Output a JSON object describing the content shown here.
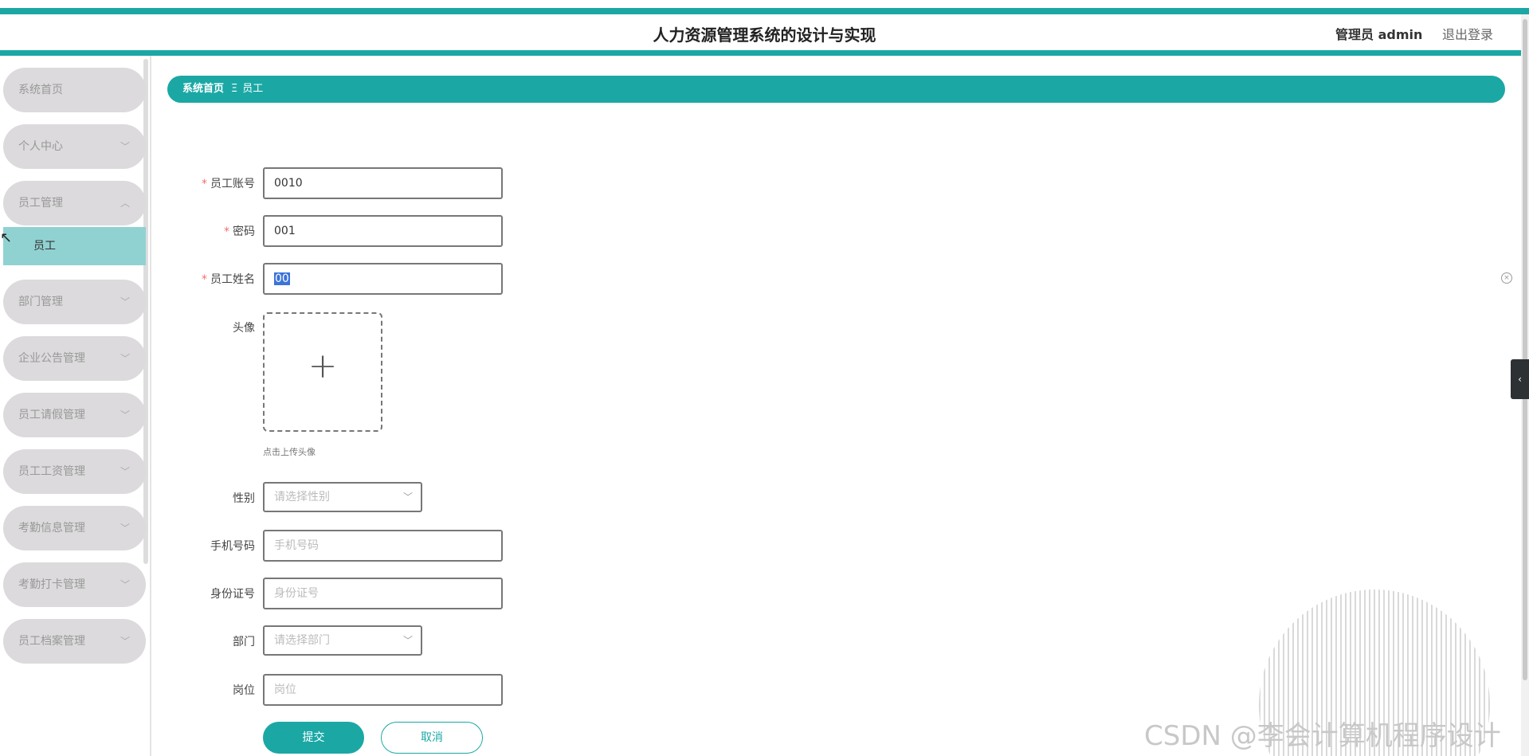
{
  "header": {
    "title": "人力资源管理系统的设计与实现",
    "user": "管理员 admin",
    "logout": "退出登录"
  },
  "sidebar": {
    "items": [
      {
        "label": "系统首页"
      },
      {
        "label": "个人中心"
      },
      {
        "label": "员工管理"
      },
      {
        "label": "部门管理"
      },
      {
        "label": "企业公告管理"
      },
      {
        "label": "员工请假管理"
      },
      {
        "label": "员工工资管理"
      },
      {
        "label": "考勤信息管理"
      },
      {
        "label": "考勤打卡管理"
      },
      {
        "label": "员工档案管理"
      }
    ],
    "sub_item": "员工"
  },
  "breadcrumb": {
    "home": "系统首页",
    "separator": "Ξ",
    "current": "员工"
  },
  "form": {
    "account_label": "员工账号",
    "account_value": "0010",
    "password_label": "密码",
    "password_value": "001",
    "name_label": "员工姓名",
    "name_value": "00",
    "avatar_label": "头像",
    "avatar_hint": "点击上传头像",
    "gender_label": "性别",
    "gender_placeholder": "请选择性别",
    "phone_label": "手机号码",
    "phone_placeholder": "手机号码",
    "idcard_label": "身份证号",
    "idcard_placeholder": "身份证号",
    "dept_label": "部门",
    "dept_placeholder": "请选择部门",
    "position_label": "岗位",
    "position_placeholder": "岗位",
    "required_mark": "*"
  },
  "buttons": {
    "submit": "提交",
    "cancel": "取消"
  },
  "watermark": "CSDN @李会计算机程序设计",
  "colors": {
    "accent": "#1ba8a5",
    "active_sub": "#90d2d1",
    "menu_bg": "#dcdadc"
  }
}
